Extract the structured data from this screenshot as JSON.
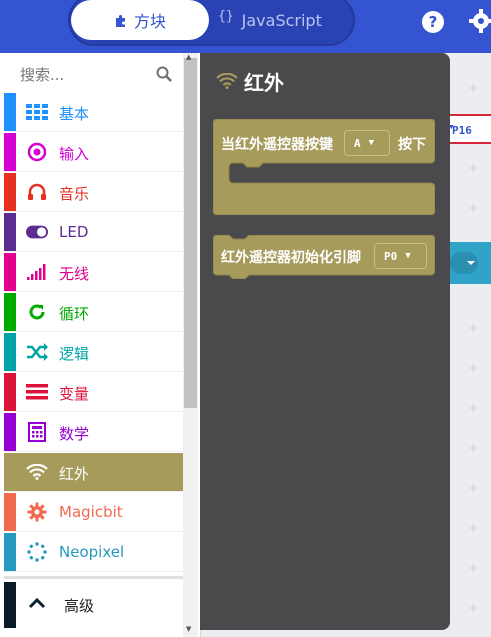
{
  "topbar": {
    "blocks_tab": "方块",
    "javascript_tab": "JavaScript",
    "help_glyph": "?"
  },
  "toolbox": {
    "search_placeholder": "搜索...",
    "categories": [
      {
        "label": "基本",
        "color": "#1e90ff",
        "icon": "grid-icon"
      },
      {
        "label": "输入",
        "color": "#d400d4",
        "icon": "target-icon"
      },
      {
        "label": "音乐",
        "color": "#e63022",
        "icon": "headphones-icon"
      },
      {
        "label": "LED",
        "color": "#5c2d91",
        "icon": "toggle-icon"
      },
      {
        "label": "无线",
        "color": "#e3008c",
        "icon": "signal-bars-icon"
      },
      {
        "label": "循环",
        "color": "#00aa00",
        "icon": "refresh-icon"
      },
      {
        "label": "逻辑",
        "color": "#00a4a6",
        "icon": "shuffle-icon"
      },
      {
        "label": "变量",
        "color": "#dc143c",
        "icon": "list-icon"
      },
      {
        "label": "数学",
        "color": "#9400d3",
        "icon": "calculator-icon"
      },
      {
        "label": "红外",
        "color": "#a69b5b",
        "icon": "wifi-icon"
      },
      {
        "label": "Magicbit",
        "color": "#ef6a4f",
        "icon": "gear-icon"
      },
      {
        "label": "Neopixel",
        "color": "#2699bf",
        "icon": "dotted-circle-icon"
      }
    ],
    "advanced_label": "高级"
  },
  "flyout": {
    "title": "红外",
    "block1": {
      "prefix": "当红外遥控器按键",
      "dropdown": "A",
      "suffix": "按下"
    },
    "block2": {
      "text": "红外遥控器初始化引脚",
      "dropdown": "P0"
    }
  },
  "workspace": {
    "pin_value": "P16"
  }
}
